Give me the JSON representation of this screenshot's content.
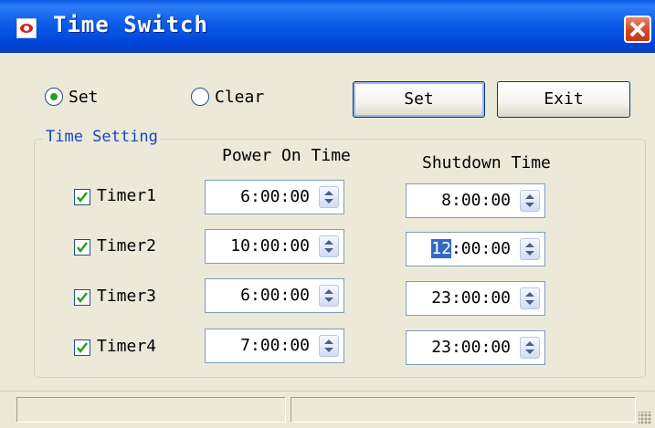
{
  "window": {
    "title": "Time Switch",
    "icon": "app-eye-icon",
    "close_icon": "close-icon"
  },
  "mode": {
    "options": [
      {
        "label": "Set",
        "selected": true
      },
      {
        "label": "Clear",
        "selected": false
      }
    ]
  },
  "buttons": {
    "set_label": "Set",
    "exit_label": "Exit"
  },
  "group": {
    "legend": "Time Setting",
    "power_on_header": "Power On Time",
    "shutdown_header": "Shutdown Time"
  },
  "timers": [
    {
      "label": "Timer1",
      "checked": true,
      "power_on": "6:00:00",
      "shutdown": "8:00:00"
    },
    {
      "label": "Timer2",
      "checked": true,
      "power_on": "10:00:00",
      "shutdown_selected_part": "12",
      "shutdown_rest": ":00:00"
    },
    {
      "label": "Timer3",
      "checked": true,
      "power_on": "6:00:00",
      "shutdown": "23:00:00"
    },
    {
      "label": "Timer4",
      "checked": true,
      "power_on": "7:00:00",
      "shutdown": "23:00:00"
    }
  ],
  "colors": {
    "titlebar": "#0b5ce8",
    "legend_text": "#1046c8",
    "check_mark": "#21a121",
    "selection": "#316ac5"
  }
}
